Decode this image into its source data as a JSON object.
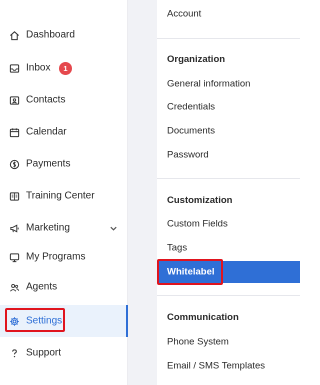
{
  "sidebar": {
    "items": [
      {
        "label": "Dashboard",
        "icon": "home-icon"
      },
      {
        "label": "Inbox",
        "icon": "inbox-icon",
        "badge": "1"
      },
      {
        "label": "Contacts",
        "icon": "contacts-icon"
      },
      {
        "label": "Calendar",
        "icon": "calendar-icon"
      },
      {
        "label": "Payments",
        "icon": "payments-icon"
      },
      {
        "label": "Training Center",
        "icon": "training-icon"
      },
      {
        "label": "Marketing",
        "icon": "megaphone-icon"
      },
      {
        "label": "My Programs",
        "icon": "monitor-icon"
      },
      {
        "label": "Agents",
        "icon": "agents-icon"
      },
      {
        "label": "Settings",
        "icon": "gear-icon",
        "active": true
      },
      {
        "label": "Support",
        "icon": "question-icon"
      }
    ]
  },
  "settings_panel": {
    "top_item": "Account",
    "sections": [
      {
        "title": "Organization",
        "items": [
          "General information",
          "Credentials",
          "Documents",
          "Password"
        ]
      },
      {
        "title": "Customization",
        "items": [
          "Custom Fields",
          "Tags",
          "Whitelabel"
        ]
      },
      {
        "title": "Communication",
        "items": [
          "Phone System",
          "Email / SMS Templates"
        ]
      }
    ],
    "selected_item": "Whitelabel"
  },
  "colors": {
    "accent": "#2f6fd6",
    "active_bg": "#eaf2fc",
    "badge": "#e5484d",
    "highlight_box": "#e0141e",
    "gap_bg": "#f1f2f6"
  }
}
